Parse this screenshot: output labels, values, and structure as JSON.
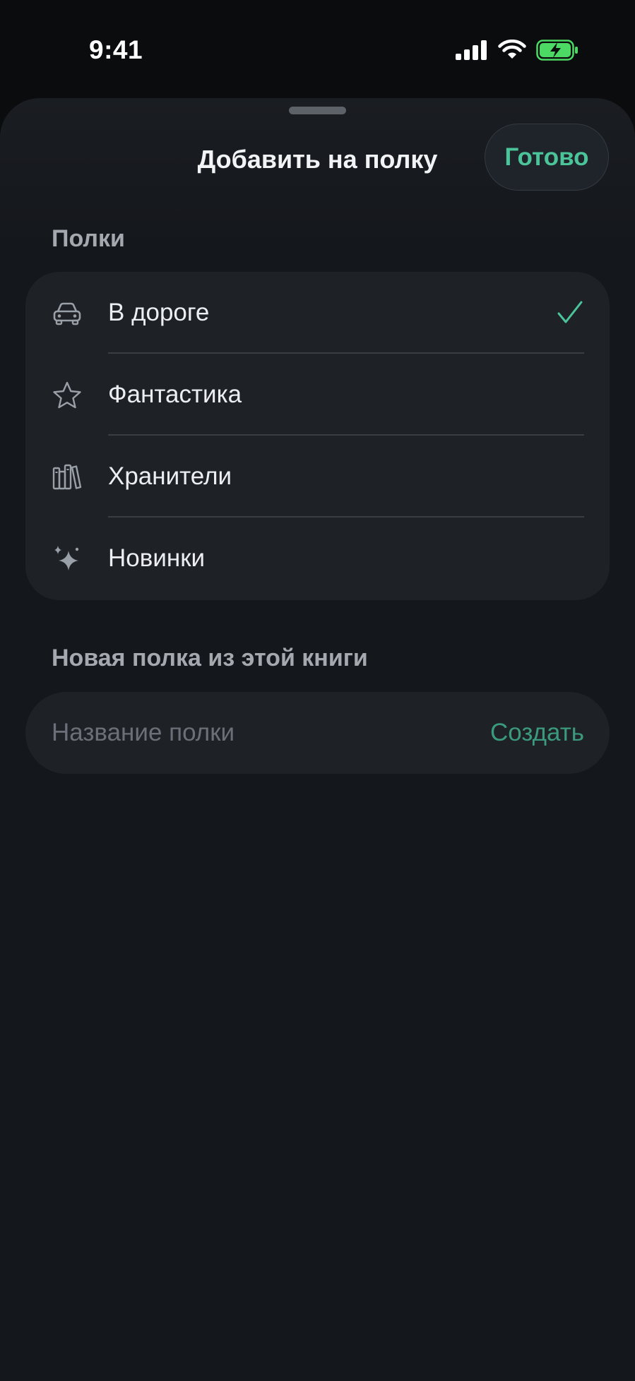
{
  "status_bar": {
    "time": "9:41",
    "battery_color": "#4cd964"
  },
  "sheet": {
    "title": "Добавить на полку",
    "done_label": "Готово",
    "accent_color": "#4bc49a"
  },
  "shelves": {
    "header": "Полки",
    "items": [
      {
        "label": "В дороге",
        "icon": "car-icon",
        "checked": true
      },
      {
        "label": "Фантастика",
        "icon": "star-icon",
        "checked": false
      },
      {
        "label": "Хранители",
        "icon": "books-icon",
        "checked": false
      },
      {
        "label": "Новинки",
        "icon": "sparkles-icon",
        "checked": false
      }
    ]
  },
  "new_shelf": {
    "header": "Новая полка из этой книги",
    "placeholder": "Название полки",
    "value": "",
    "create_label": "Создать"
  }
}
